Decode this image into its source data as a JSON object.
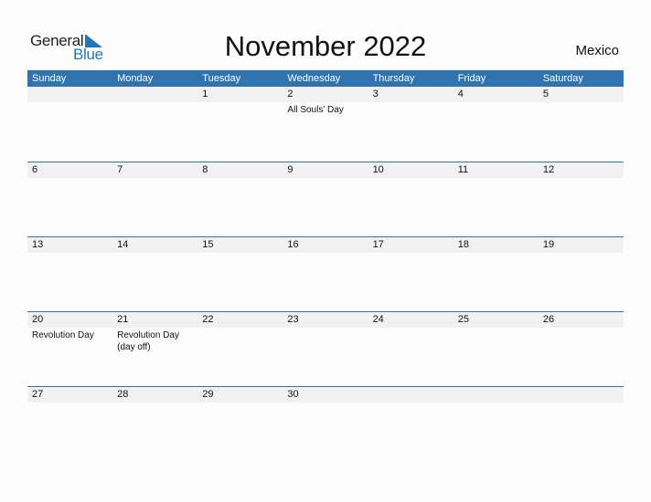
{
  "logo": {
    "line1": "General",
    "line2": "Blue",
    "accent_color": "#1f77c2"
  },
  "title": "November 2022",
  "country": "Mexico",
  "header_color": "#2f73b1",
  "weekdays": [
    "Sunday",
    "Monday",
    "Tuesday",
    "Wednesday",
    "Thursday",
    "Friday",
    "Saturday"
  ],
  "weeks": [
    [
      {
        "d": "",
        "h": ""
      },
      {
        "d": "",
        "h": ""
      },
      {
        "d": "1",
        "h": ""
      },
      {
        "d": "2",
        "h": "All Souls' Day"
      },
      {
        "d": "3",
        "h": ""
      },
      {
        "d": "4",
        "h": ""
      },
      {
        "d": "5",
        "h": ""
      }
    ],
    [
      {
        "d": "6",
        "h": ""
      },
      {
        "d": "7",
        "h": ""
      },
      {
        "d": "8",
        "h": ""
      },
      {
        "d": "9",
        "h": ""
      },
      {
        "d": "10",
        "h": ""
      },
      {
        "d": "11",
        "h": ""
      },
      {
        "d": "12",
        "h": ""
      }
    ],
    [
      {
        "d": "13",
        "h": ""
      },
      {
        "d": "14",
        "h": ""
      },
      {
        "d": "15",
        "h": ""
      },
      {
        "d": "16",
        "h": ""
      },
      {
        "d": "17",
        "h": ""
      },
      {
        "d": "18",
        "h": ""
      },
      {
        "d": "19",
        "h": ""
      }
    ],
    [
      {
        "d": "20",
        "h": "Revolution Day"
      },
      {
        "d": "21",
        "h": "Revolution Day (day off)"
      },
      {
        "d": "22",
        "h": ""
      },
      {
        "d": "23",
        "h": ""
      },
      {
        "d": "24",
        "h": ""
      },
      {
        "d": "25",
        "h": ""
      },
      {
        "d": "26",
        "h": ""
      }
    ],
    [
      {
        "d": "27",
        "h": ""
      },
      {
        "d": "28",
        "h": ""
      },
      {
        "d": "29",
        "h": ""
      },
      {
        "d": "30",
        "h": ""
      },
      {
        "d": "",
        "h": ""
      },
      {
        "d": "",
        "h": ""
      },
      {
        "d": "",
        "h": ""
      }
    ]
  ]
}
